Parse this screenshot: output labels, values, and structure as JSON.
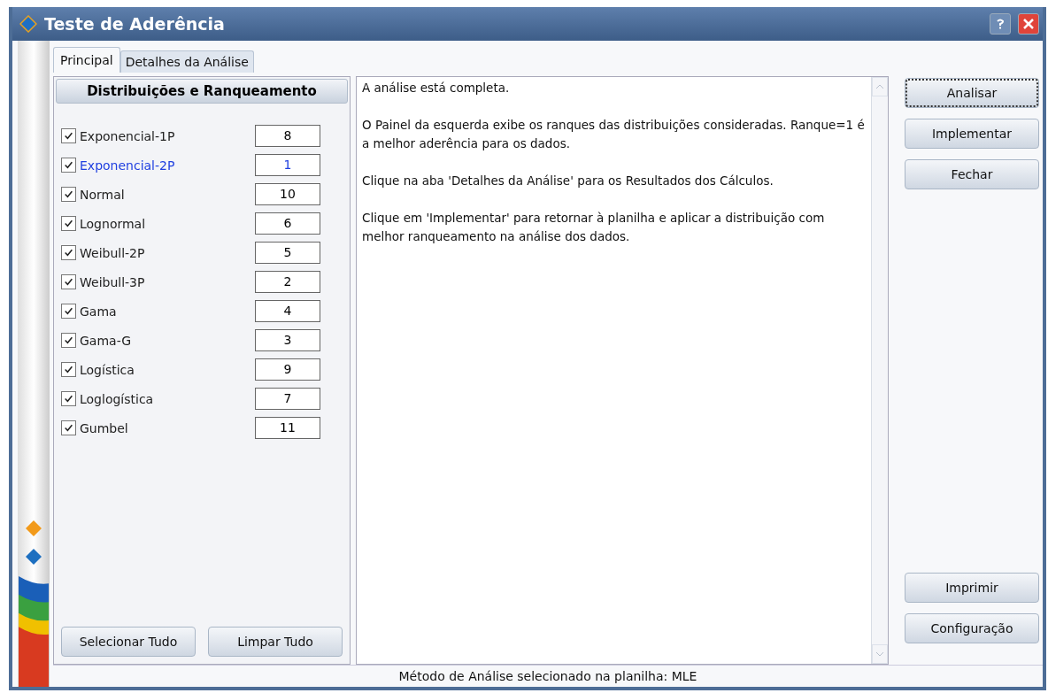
{
  "window": {
    "title": "Teste de Aderência"
  },
  "tabs": [
    {
      "label": "Principal",
      "selected": true
    },
    {
      "label": "Detalhes da Análise",
      "selected": false
    }
  ],
  "ranking_panel": {
    "title": "Distribuições e Ranqueamento",
    "distributions": [
      {
        "name": "Exponencial-1P",
        "checked": true,
        "selected": false,
        "rank": "8"
      },
      {
        "name": "Exponencial-2P",
        "checked": true,
        "selected": true,
        "rank": "1"
      },
      {
        "name": "Normal",
        "checked": true,
        "selected": false,
        "rank": "10"
      },
      {
        "name": "Lognormal",
        "checked": true,
        "selected": false,
        "rank": "6"
      },
      {
        "name": "Weibull-2P",
        "checked": true,
        "selected": false,
        "rank": "5"
      },
      {
        "name": "Weibull-3P",
        "checked": true,
        "selected": false,
        "rank": "2"
      },
      {
        "name": "Gama",
        "checked": true,
        "selected": false,
        "rank": "4"
      },
      {
        "name": "Gama-G",
        "checked": true,
        "selected": false,
        "rank": "3"
      },
      {
        "name": "Logística",
        "checked": true,
        "selected": false,
        "rank": "9"
      },
      {
        "name": "Loglogística",
        "checked": true,
        "selected": false,
        "rank": "7"
      },
      {
        "name": "Gumbel",
        "checked": true,
        "selected": false,
        "rank": "11"
      }
    ],
    "buttons": [
      "Selecionar Tudo",
      "Limpar Tudo"
    ]
  },
  "message": [
    "A análise está completa.",
    "O Painel da esquerda exibe os ranques das distribuições consideradas. Ranque=1 é a melhor aderência para os dados.",
    "Clique na aba 'Detalhes da Análise' para os Resultados dos Cálculos.",
    "Clique em 'Implementar' para retornar à planilha e aplicar a distribuição com melhor ranqueamento na análise dos dados."
  ],
  "actions_top": [
    {
      "label": "Analisar",
      "focused": true
    },
    {
      "label": "Implementar",
      "focused": false
    },
    {
      "label": "Fechar",
      "focused": false
    }
  ],
  "actions_bottom": [
    {
      "label": "Imprimir",
      "focused": false
    },
    {
      "label": "Configuração",
      "focused": false
    }
  ],
  "status_bar": "Método de Análise selecionado na planilha: MLE"
}
